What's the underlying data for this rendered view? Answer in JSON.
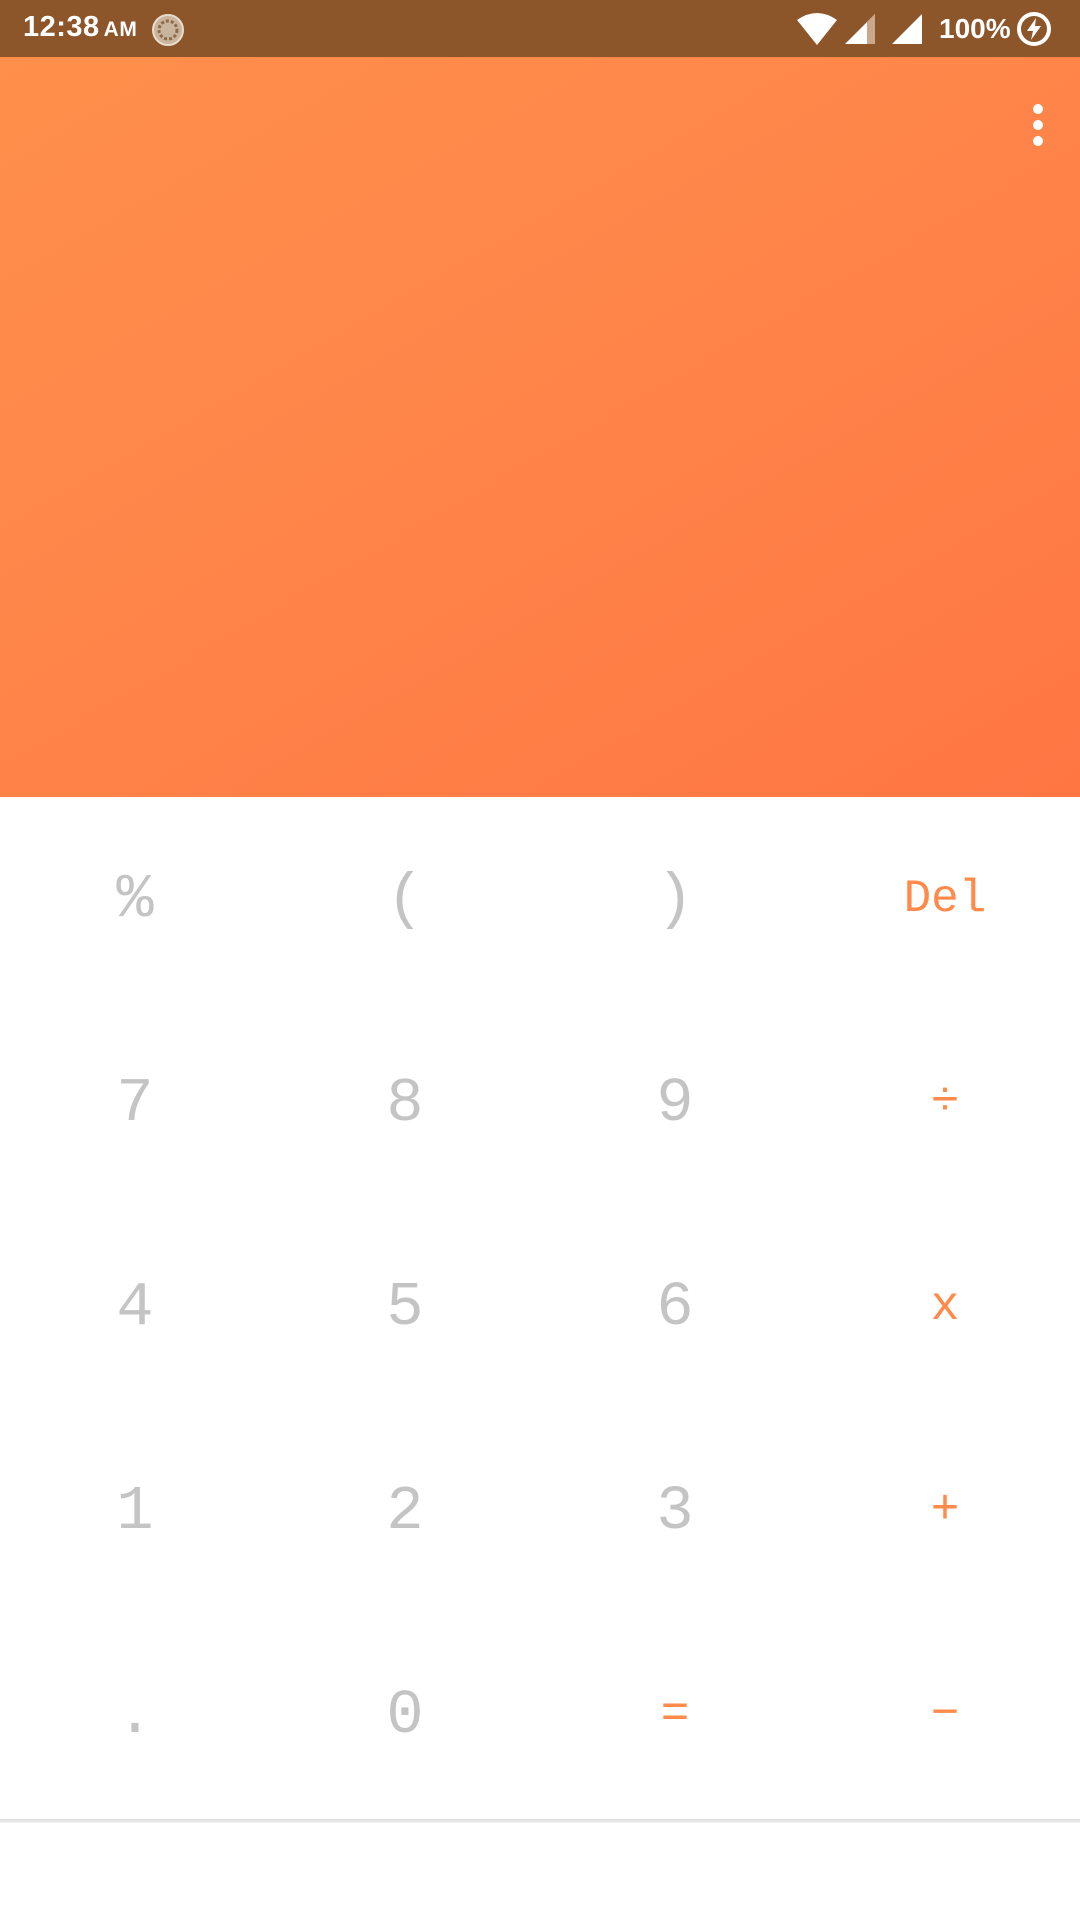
{
  "status_bar": {
    "time": "12:38",
    "ampm": "AM",
    "battery": "100%",
    "icons": [
      "sync-notification-icon",
      "wifi-icon",
      "signal-icon",
      "signal-icon",
      "charging-icon"
    ]
  },
  "display": {
    "menu_icon": "more-vert-icon"
  },
  "keypad": {
    "rows": [
      [
        "%",
        "(",
        ")",
        "Del"
      ],
      [
        "7",
        "8",
        "9",
        "÷"
      ],
      [
        "4",
        "5",
        "6",
        "x"
      ],
      [
        "1",
        "2",
        "3",
        "+"
      ],
      [
        ".",
        "0",
        "=",
        "−"
      ]
    ]
  },
  "colors": {
    "status_bar": "#8d552a",
    "accent": "#ff8a4a",
    "digit": "#c4c4c4",
    "display_gradient_start": "#ff8f4b",
    "display_gradient_end": "#ff7643"
  }
}
